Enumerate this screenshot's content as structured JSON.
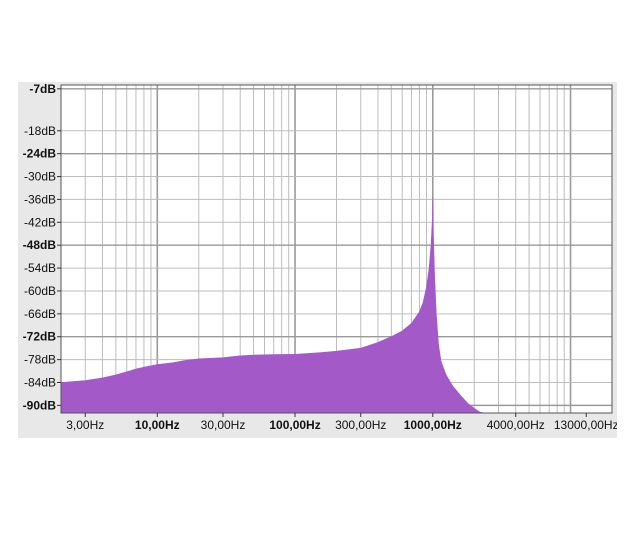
{
  "chart_data": {
    "type": "area",
    "title": "",
    "xlabel": "",
    "ylabel": "",
    "x_scale": "log",
    "xlim": [
      2.0,
      20000
    ],
    "ylim": [
      -92,
      -6
    ],
    "grid": true,
    "fill_color": "#a35ac8",
    "y_ticks": [
      {
        "label": "-7dB",
        "value": -7,
        "bold": true
      },
      {
        "label": "-18dB",
        "value": -18,
        "bold": false
      },
      {
        "label": "-24dB",
        "value": -24,
        "bold": true
      },
      {
        "label": "-30dB",
        "value": -30,
        "bold": false
      },
      {
        "label": "-36dB",
        "value": -36,
        "bold": false
      },
      {
        "label": "-42dB",
        "value": -42,
        "bold": false
      },
      {
        "label": "-48dB",
        "value": -48,
        "bold": true
      },
      {
        "label": "-54dB",
        "value": -54,
        "bold": false
      },
      {
        "label": "-60dB",
        "value": -60,
        "bold": false
      },
      {
        "label": "-66dB",
        "value": -66,
        "bold": false
      },
      {
        "label": "-72dB",
        "value": -72,
        "bold": true
      },
      {
        "label": "-78dB",
        "value": -78,
        "bold": false
      },
      {
        "label": "-84dB",
        "value": -84,
        "bold": false
      },
      {
        "label": "-90dB",
        "value": -90,
        "bold": true
      }
    ],
    "x_ticks": [
      {
        "label": "3,00Hz",
        "value": 3,
        "bold": false
      },
      {
        "label": "10,00Hz",
        "value": 10,
        "bold": true
      },
      {
        "label": "30,00Hz",
        "value": 30,
        "bold": false
      },
      {
        "label": "100,00Hz",
        "value": 100,
        "bold": true
      },
      {
        "label": "300,00Hz",
        "value": 300,
        "bold": false
      },
      {
        "label": "1000,00Hz",
        "value": 1000,
        "bold": true
      },
      {
        "label": "4000,00Hz",
        "value": 4000,
        "bold": false
      },
      {
        "label": "13000,00Hz",
        "value": 13000,
        "bold": false
      }
    ],
    "series": [
      {
        "x": [
          2.0,
          3,
          4,
          5,
          6,
          7,
          8,
          10,
          13,
          16,
          20,
          30,
          40,
          50,
          70,
          100,
          150,
          200,
          300,
          400,
          500,
          600,
          700,
          800,
          850,
          900,
          940,
          970,
          990,
          1000,
          1010,
          1030,
          1060,
          1100,
          1150,
          1250,
          1400,
          1600,
          1800,
          2000,
          2200,
          2400
        ],
        "y": [
          -84,
          -83.5,
          -82.8,
          -82,
          -81.2,
          -80.5,
          -80,
          -79.3,
          -78.8,
          -78.2,
          -77.8,
          -77.5,
          -77,
          -76.8,
          -76.7,
          -76.6,
          -76.2,
          -75.8,
          -75,
          -73.5,
          -72,
          -70.5,
          -68.5,
          -65.5,
          -63,
          -59,
          -54,
          -48,
          -42,
          -35.5,
          -45,
          -56,
          -66,
          -74,
          -78.5,
          -82,
          -85,
          -87.5,
          -89.5,
          -90.8,
          -91.8,
          -92
        ]
      }
    ]
  }
}
